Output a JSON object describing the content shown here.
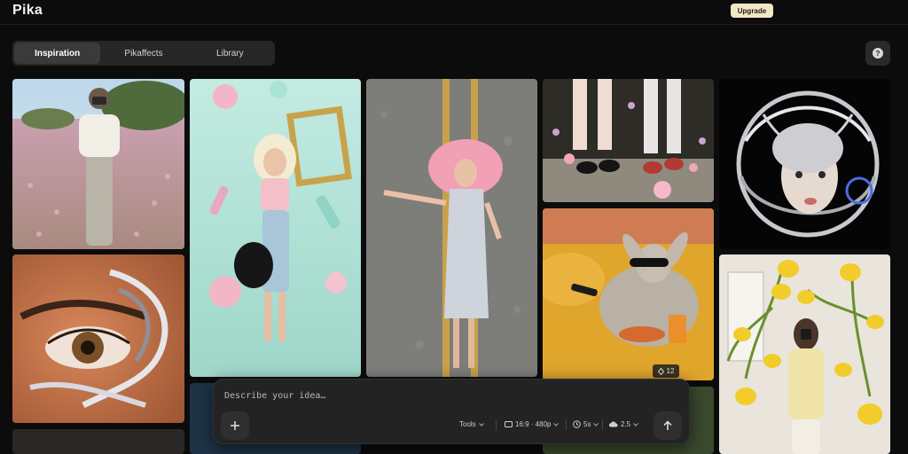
{
  "header": {
    "logo": "Pika",
    "upgrade_label": "Upgrade"
  },
  "tabs": [
    {
      "label": "Inspiration",
      "active": true
    },
    {
      "label": "Pikaffects",
      "active": false
    },
    {
      "label": "Library",
      "active": false
    }
  ],
  "help_label": "?",
  "gallery": {
    "badge_icon": "diamond-icon",
    "badge_count": "12"
  },
  "prompt": {
    "placeholder": "Describe your idea…",
    "tools_label": "Tools",
    "aspect_label": "16:9 · 480p",
    "duration_label": "5s",
    "model_label": "2.5"
  },
  "colors": {
    "background": "#0c0c0c",
    "upgrade": "#f3e6c4",
    "panel": "#232323"
  }
}
